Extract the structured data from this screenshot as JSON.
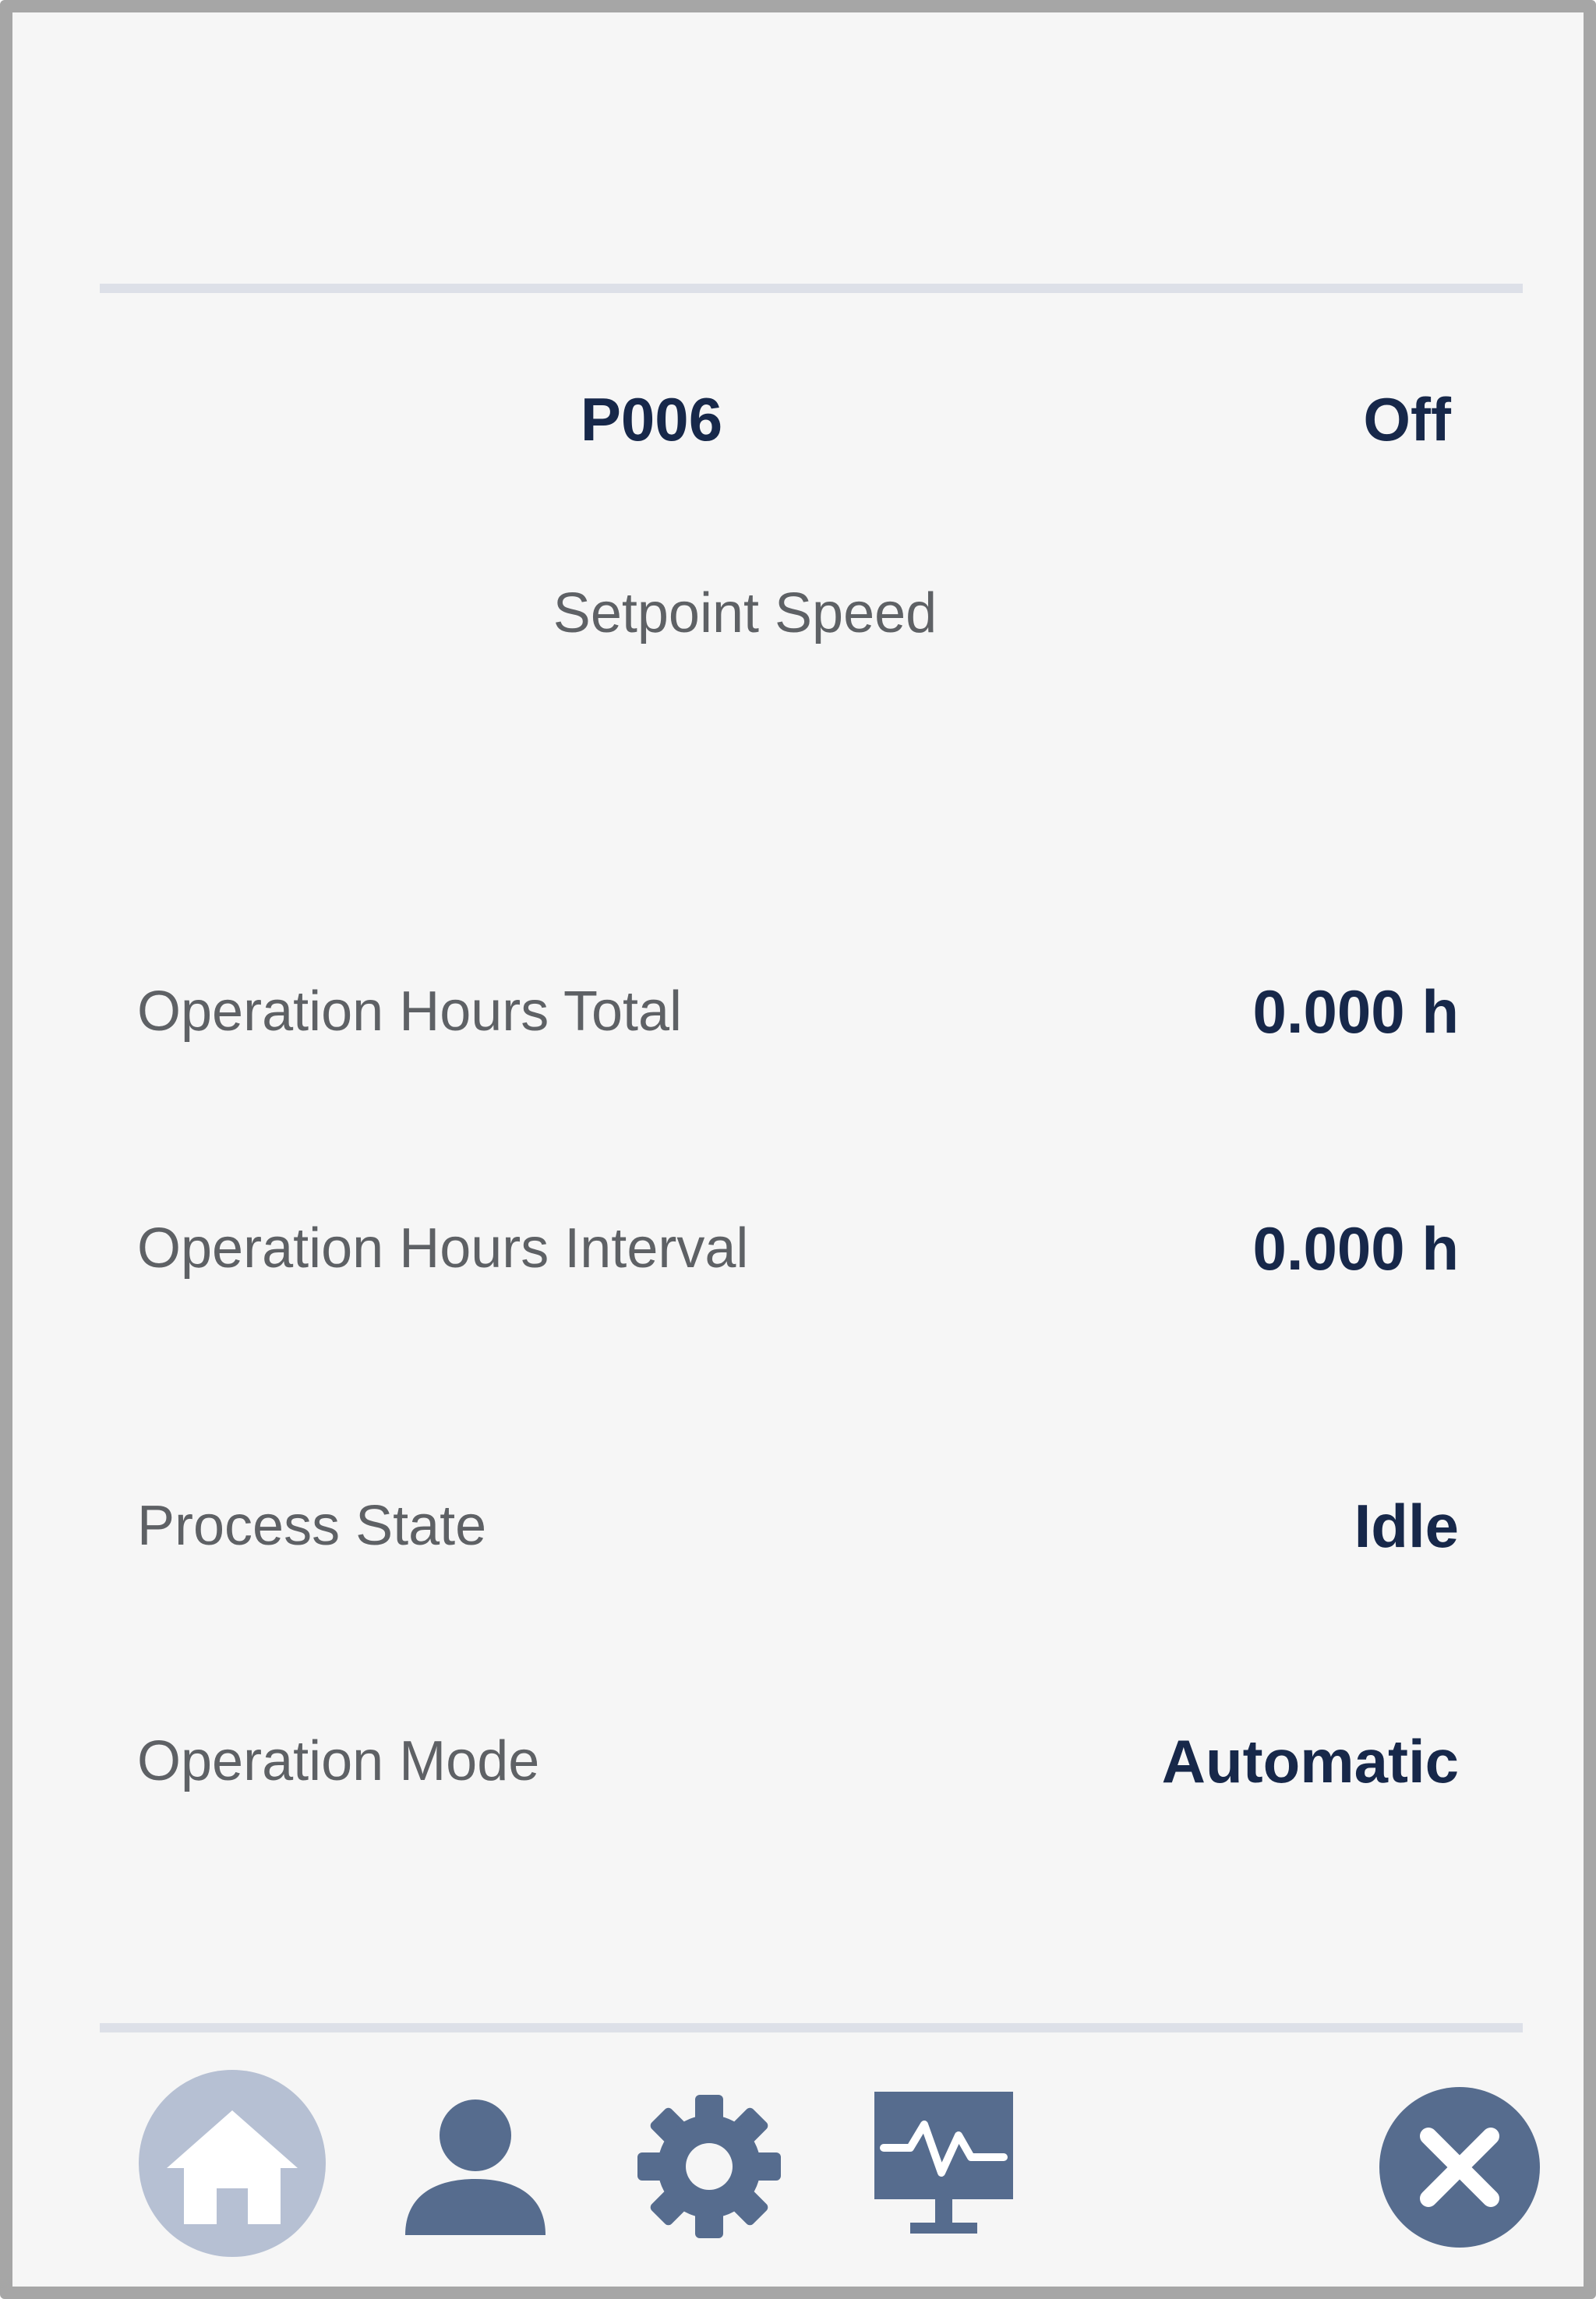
{
  "header": {
    "device_id": "P006",
    "device_state": "Off",
    "subtitle": "Setpoint Speed"
  },
  "rows": [
    {
      "label": "Operation Hours Total",
      "value": "0.000 h"
    },
    {
      "label": "Operation Hours Interval",
      "value": "0.000 h"
    },
    {
      "label": "Process State",
      "value": "Idle"
    },
    {
      "label": "Operation Mode",
      "value": "Automatic"
    }
  ],
  "toolbar": {
    "items": [
      {
        "icon": "home-icon",
        "active": true
      },
      {
        "icon": "user-icon",
        "active": false
      },
      {
        "icon": "gear-icon",
        "active": false
      },
      {
        "icon": "monitor-icon",
        "active": false
      },
      {
        "icon": "close-icon",
        "active": false
      }
    ]
  },
  "colors": {
    "primary_text": "#17284a",
    "secondary_text": "#5e6165",
    "icon": "#566c8e",
    "active_icon_bg": "#b6c0d3",
    "divider": "#dde0e8",
    "background": "#f6f6f6"
  }
}
